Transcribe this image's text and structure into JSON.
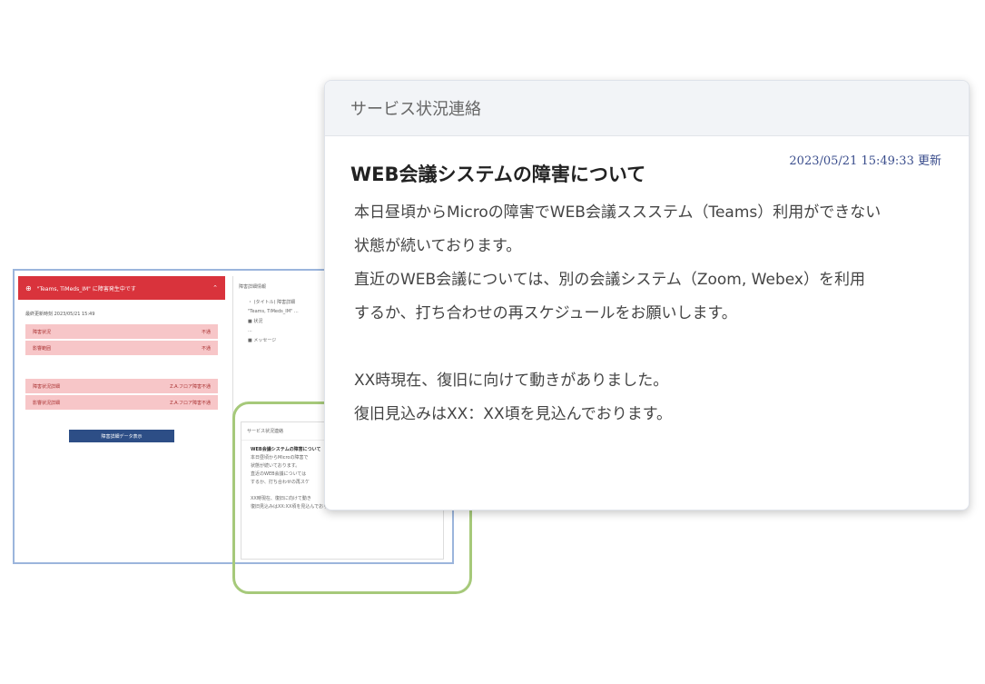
{
  "mini": {
    "alert_text": "\"Teams, TiMeds_IM\" に障害発生中です",
    "date_text": "最終更新時刻  2023/05/21 15:49",
    "rows_top": [
      {
        "label": "障害状況",
        "status": "不通"
      },
      {
        "label": "影響範囲",
        "status": "不通"
      }
    ],
    "rows_bottom": [
      {
        "label": "障害状況詳細",
        "status": "Z.A.フロア障害不通"
      },
      {
        "label": "影響状況詳細",
        "status": "Z.A.フロア障害不通"
      }
    ],
    "button_label": "障害詳細データ表示",
    "right_title": "障害詳細情報",
    "right_lines": [
      "・ (タイトル) 障害詳細",
      "\"Teams, TiMeds_IM\" ...",
      "■ 状況",
      "...",
      "■ メッセージ"
    ],
    "card_title": "サービス状況連絡",
    "card_head": "WEB会議システムの障害について",
    "card_lines": [
      "本日昼頃からMicroの障害で",
      "状態が続いております。",
      "直近のWEB会議については",
      "するか、打ち合わせの再スケ",
      "",
      "XX時現在、復旧に向けて動き",
      "復旧見込みはXX:XX頃を見込んでおります。"
    ]
  },
  "card": {
    "header": "サービス状況連絡",
    "title": "WEB会議システムの障害について",
    "timestamp": "2023/05/21 15:49:33 更新",
    "lines": [
      "本日昼頃からMicroの障害でWEB会議ススステム（Teams）利用ができない",
      "状態が続いております。",
      "直近のWEB会議については、別の会議システム（Zoom, Webex）を利用",
      "するか、打ち合わせの再スケジュールをお願いします。",
      "XX時現在、復旧に向けて動きがありました。",
      "復旧見込みはXX：XX頃を見込んでおります。"
    ]
  },
  "colors": {
    "alert_red": "#d9333c",
    "alert_row": "#f7c6c8",
    "button_navy": "#2d4e86",
    "highlight_green": "#a6c97a",
    "frame_blue": "#9bb5dc"
  }
}
